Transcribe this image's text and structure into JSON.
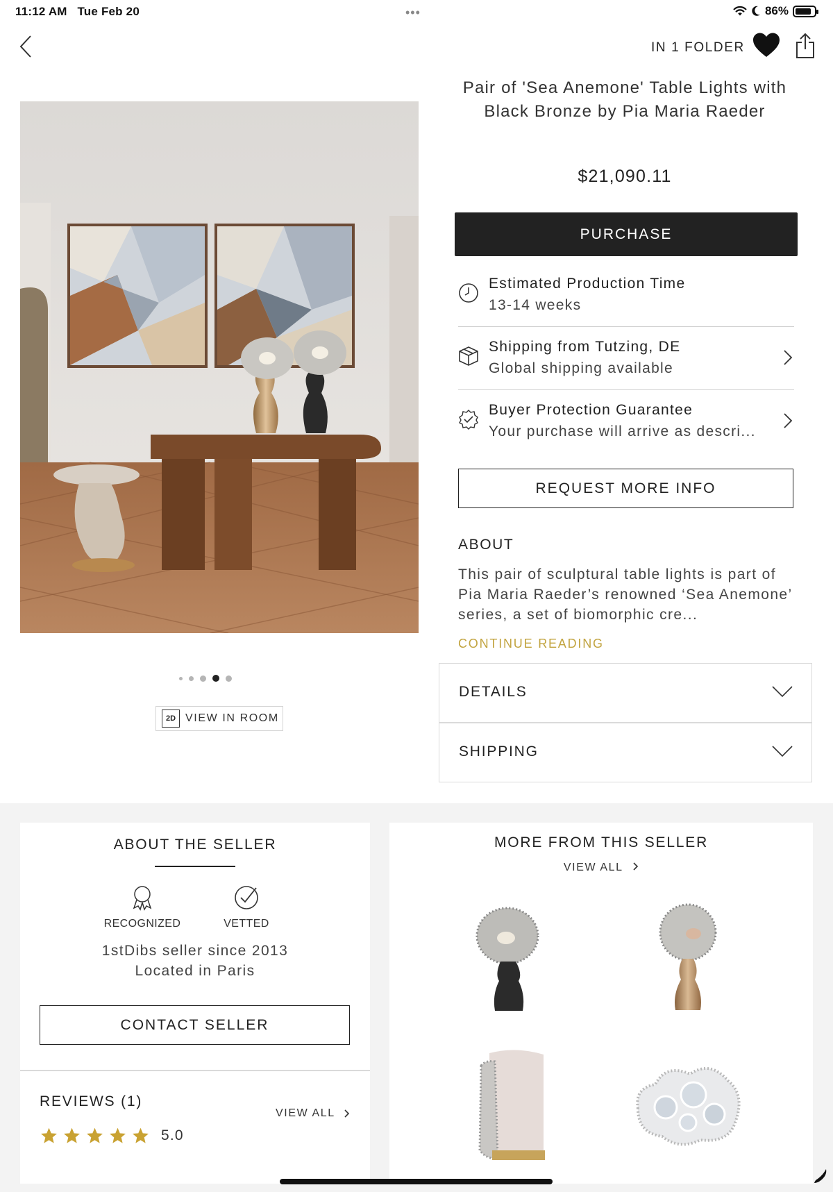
{
  "status_bar": {
    "time": "11:12 AM",
    "date": "Tue Feb 20",
    "battery": "86%",
    "battery_level": 0.86
  },
  "nav": {
    "folder_label": "IN 1 FOLDER"
  },
  "product": {
    "title": "Pair of 'Sea Anemone' Table Lights with Black Bronze by Pia Maria Raeder",
    "price": "$21,090.11",
    "purchase_label": "PURCHASE",
    "carousel": {
      "count": 5,
      "active_index": 3
    },
    "view_in_room_icon": "2D",
    "view_in_room_label": "VIEW IN ROOM"
  },
  "info_rows": [
    {
      "icon": "clock-icon",
      "title": "Estimated Production Time",
      "subtitle": "13-14 weeks",
      "has_chevron": false
    },
    {
      "icon": "package-icon",
      "title": "Shipping from Tutzing, DE",
      "subtitle": "Global shipping available",
      "has_chevron": true
    },
    {
      "icon": "shield-check-icon",
      "title": "Buyer Protection Guarantee",
      "subtitle": "Your purchase will arrive as descri...",
      "has_chevron": true
    }
  ],
  "request_more_info_label": "REQUEST MORE INFO",
  "about": {
    "heading": "ABOUT",
    "text": "This pair of sculptural table lights is part of Pia Maria Raeder’s renowned ‘Sea Anemone’ series, a set of biomorphic cre...",
    "continue_label": "CONTINUE READING"
  },
  "accordions": [
    {
      "label": "DETAILS"
    },
    {
      "label": "SHIPPING"
    }
  ],
  "seller": {
    "heading": "ABOUT THE SELLER",
    "badges": [
      {
        "icon": "award-ribbon-icon",
        "label": "RECOGNIZED"
      },
      {
        "icon": "check-circle-icon",
        "label": "VETTED"
      }
    ],
    "since": "1stDibs seller since 2013",
    "location": "Located in Paris",
    "contact_label": "CONTACT SELLER",
    "reviews_heading": "REVIEWS (1)",
    "reviews_view_all": "VIEW ALL",
    "rating": "5.0",
    "stars": 5
  },
  "more_from_seller": {
    "heading": "MORE FROM THIS SELLER",
    "view_all": "VIEW ALL",
    "items": [
      "black-sea-anemone-lamp",
      "bronze-sea-anemone-lamp",
      "anemone-armchair",
      "anemone-mirror"
    ]
  },
  "colors": {
    "accent_gold": "#c2a440",
    "dark": "#222222",
    "star": "#c9a232"
  }
}
